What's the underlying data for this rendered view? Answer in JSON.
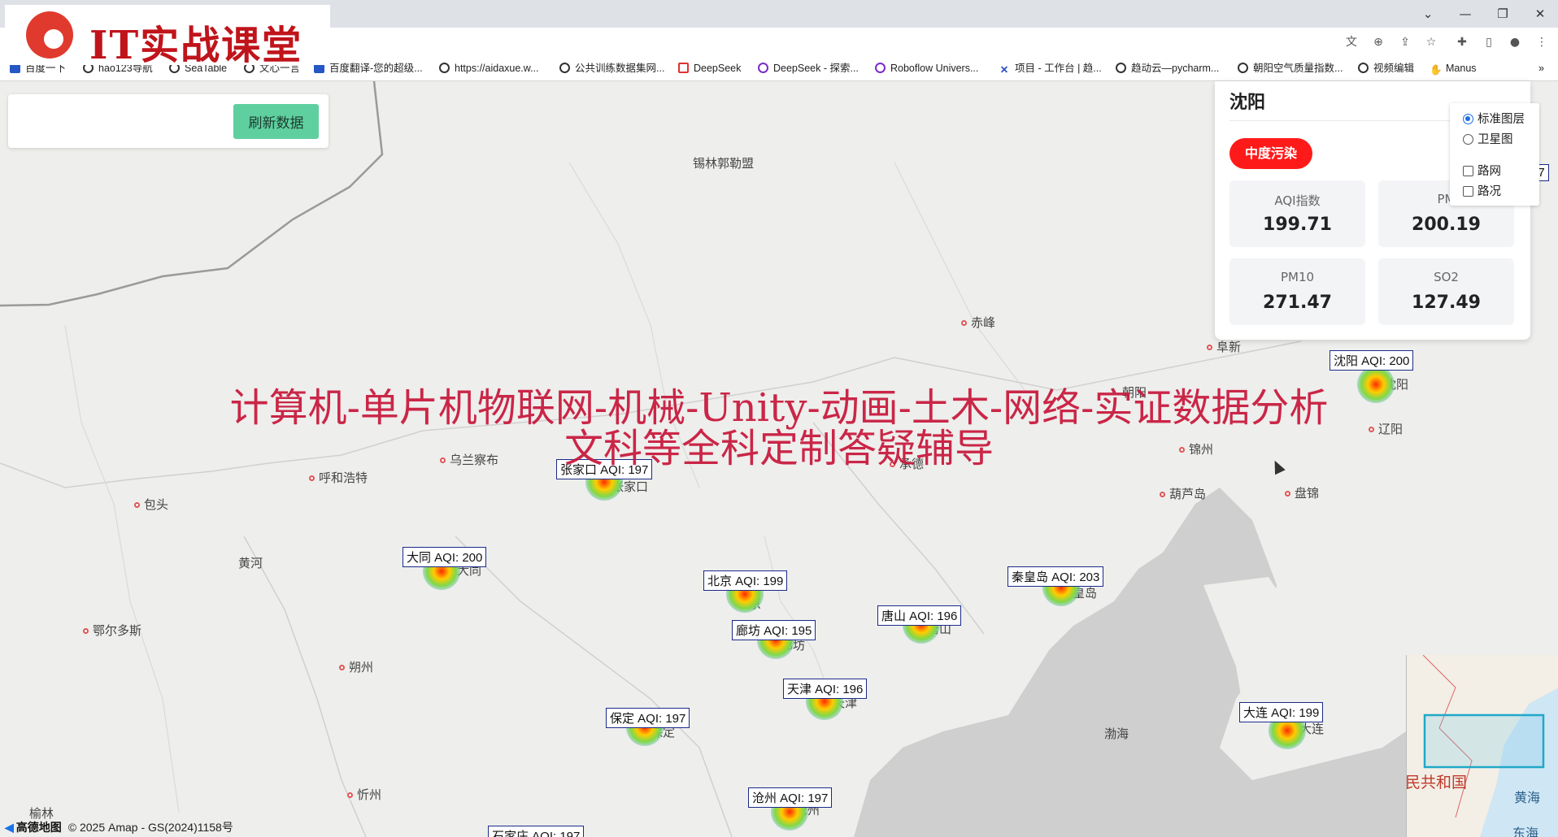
{
  "browser": {
    "bookmarks": [
      {
        "label": "百度一下",
        "icon": "paw-icon"
      },
      {
        "label": "hao123导航",
        "icon": "globe-icon"
      },
      {
        "label": "SeaTable",
        "icon": "globe-icon"
      },
      {
        "label": "文心一言",
        "icon": "globe-icon"
      },
      {
        "label": "百度翻译-您的超级...",
        "icon": "translate-icon"
      },
      {
        "label": "https://aidaxue.w...",
        "icon": "globe-icon"
      },
      {
        "label": "公共训练数据集网...",
        "icon": "globe-icon"
      },
      {
        "label": "DeepSeek",
        "icon": "deepseek-icon"
      },
      {
        "label": "DeepSeek - 探索...",
        "icon": "deepseek-icon"
      },
      {
        "label": "Roboflow Univers...",
        "icon": "roboflow-icon"
      },
      {
        "label": "项目 - 工作台 | 趋...",
        "icon": "x-icon"
      },
      {
        "label": "趋动云—pycharm...",
        "icon": "globe-icon"
      },
      {
        "label": "朝阳空气质量指数...",
        "icon": "globe-icon"
      },
      {
        "label": "视频编辑",
        "icon": "globe-icon"
      },
      {
        "label": "Manus",
        "icon": "manus-icon"
      }
    ],
    "more_bookmarks": "»"
  },
  "logo": {
    "text": "IT实战课堂"
  },
  "controls": {
    "refresh_label": "刷新数据"
  },
  "watermark": {
    "line1": "计算机-单片机物联网-机械-Unity-动画-土木-网络-实证数据分析",
    "line2": "文科等全科定制答疑辅导"
  },
  "info_panel": {
    "city": "沈阳",
    "level": "中度污染",
    "level_color": "#ff1a1a",
    "metrics": [
      {
        "name": "AQI指数",
        "value": "199.71"
      },
      {
        "name": "PM",
        "value": "200.19"
      },
      {
        "name": "PM10",
        "value": "271.47"
      },
      {
        "name": "SO2",
        "value": "127.49"
      }
    ]
  },
  "layers": {
    "base_options": [
      {
        "label": "标准图层",
        "selected": true
      },
      {
        "label": "卫星图",
        "selected": false
      }
    ],
    "overlays": [
      {
        "label": "路网",
        "checked": false
      },
      {
        "label": "路况",
        "checked": false
      }
    ]
  },
  "map": {
    "places": [
      "锡林郭勒盟",
      "赤峰",
      "阜新",
      "沈阳",
      "辽阳",
      "锦州",
      "葫芦岛",
      "盘锦",
      "乌兰察布",
      "呼和浩特",
      "张家口",
      "承德",
      "包头",
      "黄河",
      "大同",
      "鄂尔多斯",
      "朔州",
      "忻州",
      "榆林",
      "渤海",
      "朝阳",
      "秦皇岛",
      "唐山",
      "北京",
      "廊坊",
      "天津",
      "保定",
      "沧州",
      "大连"
    ],
    "aqi_labels": [
      "沈阳 AQI: 200",
      "张家口 AQI: 197",
      "大同 AQI: 200",
      "北京 AQI: 199",
      "秦皇岛 AQI: 203",
      "唐山 AQI: 196",
      "廊坊 AQI: 195",
      "天津 AQI: 196",
      "保定 AQI: 197",
      "大连 AQI: 199",
      "沧州 AQI: 197",
      "石家庄 AQI: 197"
    ],
    "partial_label": "97",
    "overview_text": [
      "民共和国",
      "黄海",
      "东海"
    ],
    "attribution": {
      "brand": "高德地图",
      "copyright": "© 2025 Amap - GS(2024)1158号"
    }
  }
}
